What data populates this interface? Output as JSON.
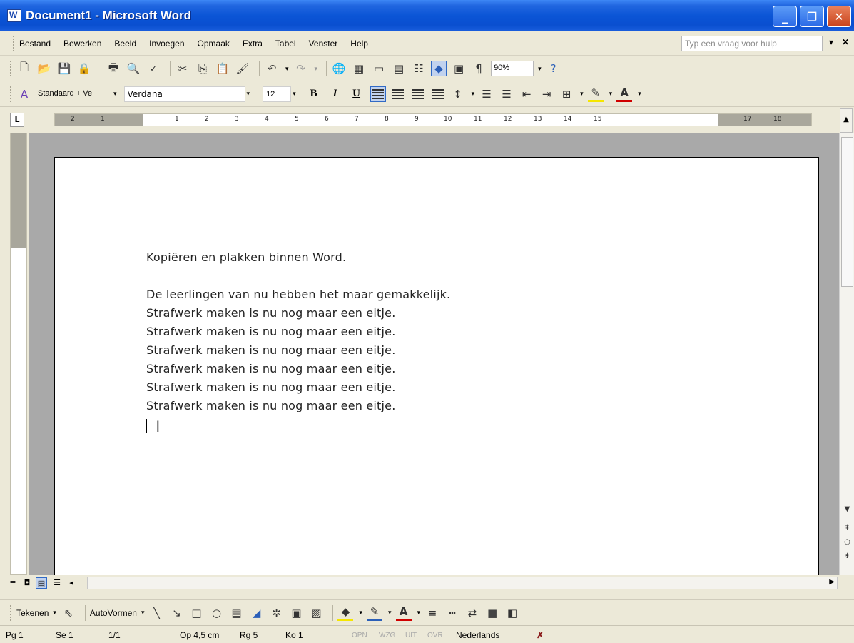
{
  "window": {
    "title": "Document1 - Microsoft Word",
    "minimize": "_",
    "maximize": "❐",
    "close": "✕"
  },
  "menu": {
    "items": [
      "Bestand",
      "Bewerken",
      "Beeld",
      "Invoegen",
      "Opmaak",
      "Extra",
      "Tabel",
      "Venster",
      "Help"
    ],
    "help_placeholder": "Typ een vraag voor hulp",
    "help_dropdown": "▾",
    "close_doc": "✕"
  },
  "standard_toolbar": {
    "zoom": "90%",
    "pilcrow": "¶",
    "help_icon": "?"
  },
  "format_toolbar": {
    "style": "Standaard + Ve",
    "font": "Verdana",
    "size": "12",
    "bold": "B",
    "italic": "I",
    "underline": "U",
    "font_color_letter": "A"
  },
  "ruler": {
    "tab_marker": "L",
    "numbers": [
      "2",
      "1",
      "1",
      "2",
      "3",
      "4",
      "5",
      "6",
      "7",
      "8",
      "9",
      "10",
      "11",
      "12",
      "13",
      "14",
      "15",
      "17",
      "18"
    ]
  },
  "document": {
    "lines": [
      "Kopiëren en plakken binnen Word.",
      "",
      "De leerlingen van nu hebben het maar gemakkelijk.",
      "Strafwerk maken is nu nog maar een eitje.",
      "Strafwerk maken is nu nog maar een eitje.",
      "Strafwerk maken is nu nog maar een eitje.",
      "Strafwerk maken is nu nog maar een eitje.",
      "Strafwerk maken is nu nog maar een eitje.",
      "Strafwerk maken is nu nog maar een eitje."
    ]
  },
  "drawing_toolbar": {
    "draw_label": "Tekenen",
    "autoshapes_label": "AutoVormen"
  },
  "status": {
    "page": "Pg 1",
    "section": "Se 1",
    "pages": "1/1",
    "at": "Op 4,5 cm",
    "line": "Rg 5",
    "column": "Ko 1",
    "rec": "OPN",
    "track": "WZG",
    "ext": "UIT",
    "ovr": "OVR",
    "language": "Nederlands"
  }
}
